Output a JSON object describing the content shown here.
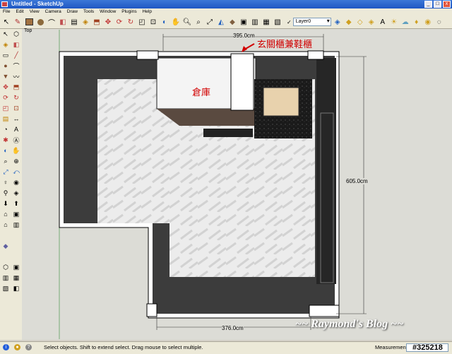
{
  "window": {
    "title": "Untitled - SketchUp"
  },
  "menus": [
    "File",
    "Edit",
    "View",
    "Camera",
    "Draw",
    "Tools",
    "Window",
    "Plugins",
    "Help"
  ],
  "layer": {
    "checked": "✓",
    "name": "Layer0"
  },
  "scene": {
    "label": "Top"
  },
  "dimensions": {
    "top": "395.0cm",
    "right": "605.0cm",
    "bottom": "376.0cm"
  },
  "annotations": {
    "entry_cabinet": "玄關櫃兼鞋櫃",
    "storage": "倉庫"
  },
  "status": {
    "hint": "Select objects. Shift to extend select. Drag mouse to select multiple.",
    "measurements_label": "Measurements",
    "measurements_value": ""
  },
  "overlay": {
    "blog": "~~ Raymond's Blog ~~",
    "watermark": "#325218"
  },
  "colors": {
    "wall": "#3a3a3a",
    "floor": "#eeeeee",
    "titlebar": "#1f57c3",
    "annotation": "#d10000"
  }
}
